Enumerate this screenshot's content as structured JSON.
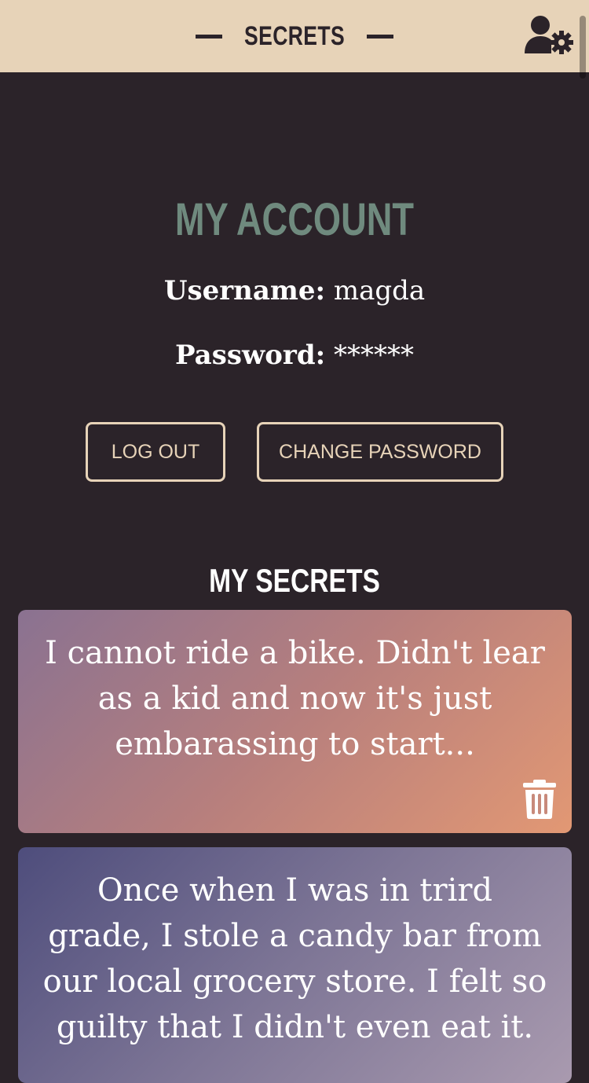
{
  "header": {
    "title": "SECRETS",
    "settings_icon": "user-gear-icon"
  },
  "account": {
    "title": "MY ACCOUNT",
    "username_label": "Username:",
    "username_value": "magda",
    "password_label": "Password:",
    "password_value": "******"
  },
  "actions": {
    "logout_label": "LOG OUT",
    "change_password_label": "CHANGE PASSWORD"
  },
  "secrets": {
    "title": "MY SECRETS",
    "items": [
      {
        "text": "I cannot ride a bike. Didn't lear as a kid and now it's just embarassing to start..."
      },
      {
        "text": "Once when I was in trird grade, I stole a candy bar from our local grocery store. I felt so guilty that I didn't even eat it."
      }
    ],
    "delete_icon": "trash-icon"
  },
  "colors": {
    "header_bg": "#e7d3b8",
    "page_bg": "#2b2329",
    "title_accent": "#6f8a7e"
  }
}
